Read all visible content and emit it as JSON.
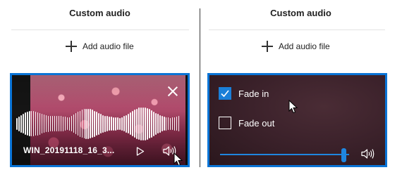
{
  "left_panel": {
    "title": "Custom audio",
    "add_label": "Add audio file",
    "clip": {
      "filename": "WIN_20191118_16_3..."
    }
  },
  "right_panel": {
    "title": "Custom audio",
    "add_label": "Add audio file",
    "settings": {
      "fade_in_label": "Fade in",
      "fade_in_checked": true,
      "fade_out_label": "Fade out",
      "fade_out_checked": false,
      "volume_level": 0.98
    }
  },
  "colors": {
    "accent": "#0a74d6",
    "settings_bg": "#3c222b"
  },
  "icons": {
    "add": "plus-icon",
    "close": "close-icon",
    "play": "play-icon",
    "volume": "speaker-icon",
    "cursor": "mouse-pointer-icon"
  }
}
